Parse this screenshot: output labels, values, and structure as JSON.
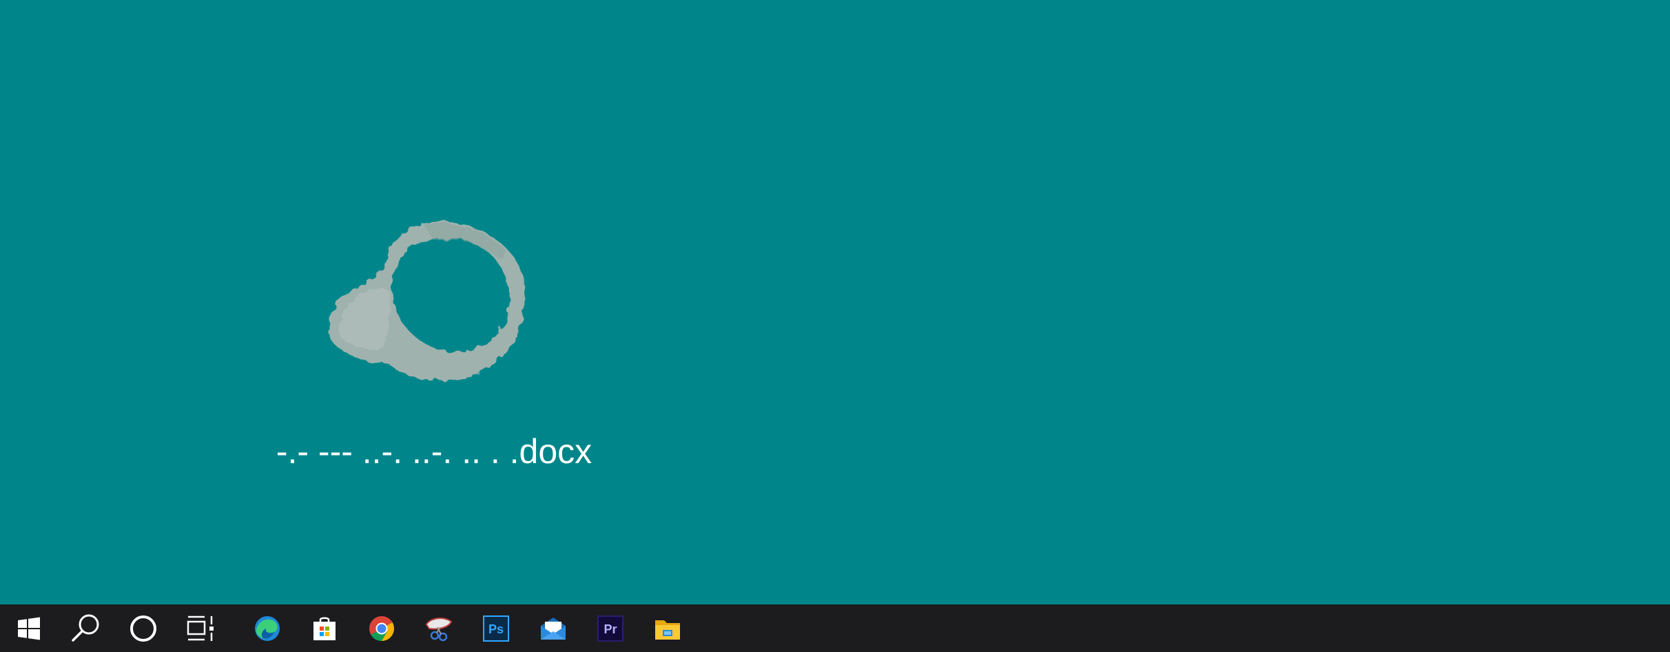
{
  "desktop": {
    "background_color": "#00868A",
    "icons": [
      {
        "label": "-.- --- ..-. ..-. .. . .docx",
        "icon": "coffee-stain-icon"
      }
    ]
  },
  "taskbar": {
    "background_color": "#1c1b1e",
    "items": [
      {
        "icon": "windows-start-icon"
      },
      {
        "icon": "search-icon"
      },
      {
        "icon": "cortana-icon"
      },
      {
        "icon": "task-view-icon"
      },
      {
        "icon": "edge-icon"
      },
      {
        "icon": "store-icon"
      },
      {
        "icon": "chrome-icon"
      },
      {
        "icon": "snipping-tool-icon"
      },
      {
        "icon": "photoshop-icon",
        "text": "Ps"
      },
      {
        "icon": "mail-icon"
      },
      {
        "icon": "premiere-icon",
        "text": "Pr"
      },
      {
        "icon": "file-explorer-icon"
      }
    ]
  }
}
